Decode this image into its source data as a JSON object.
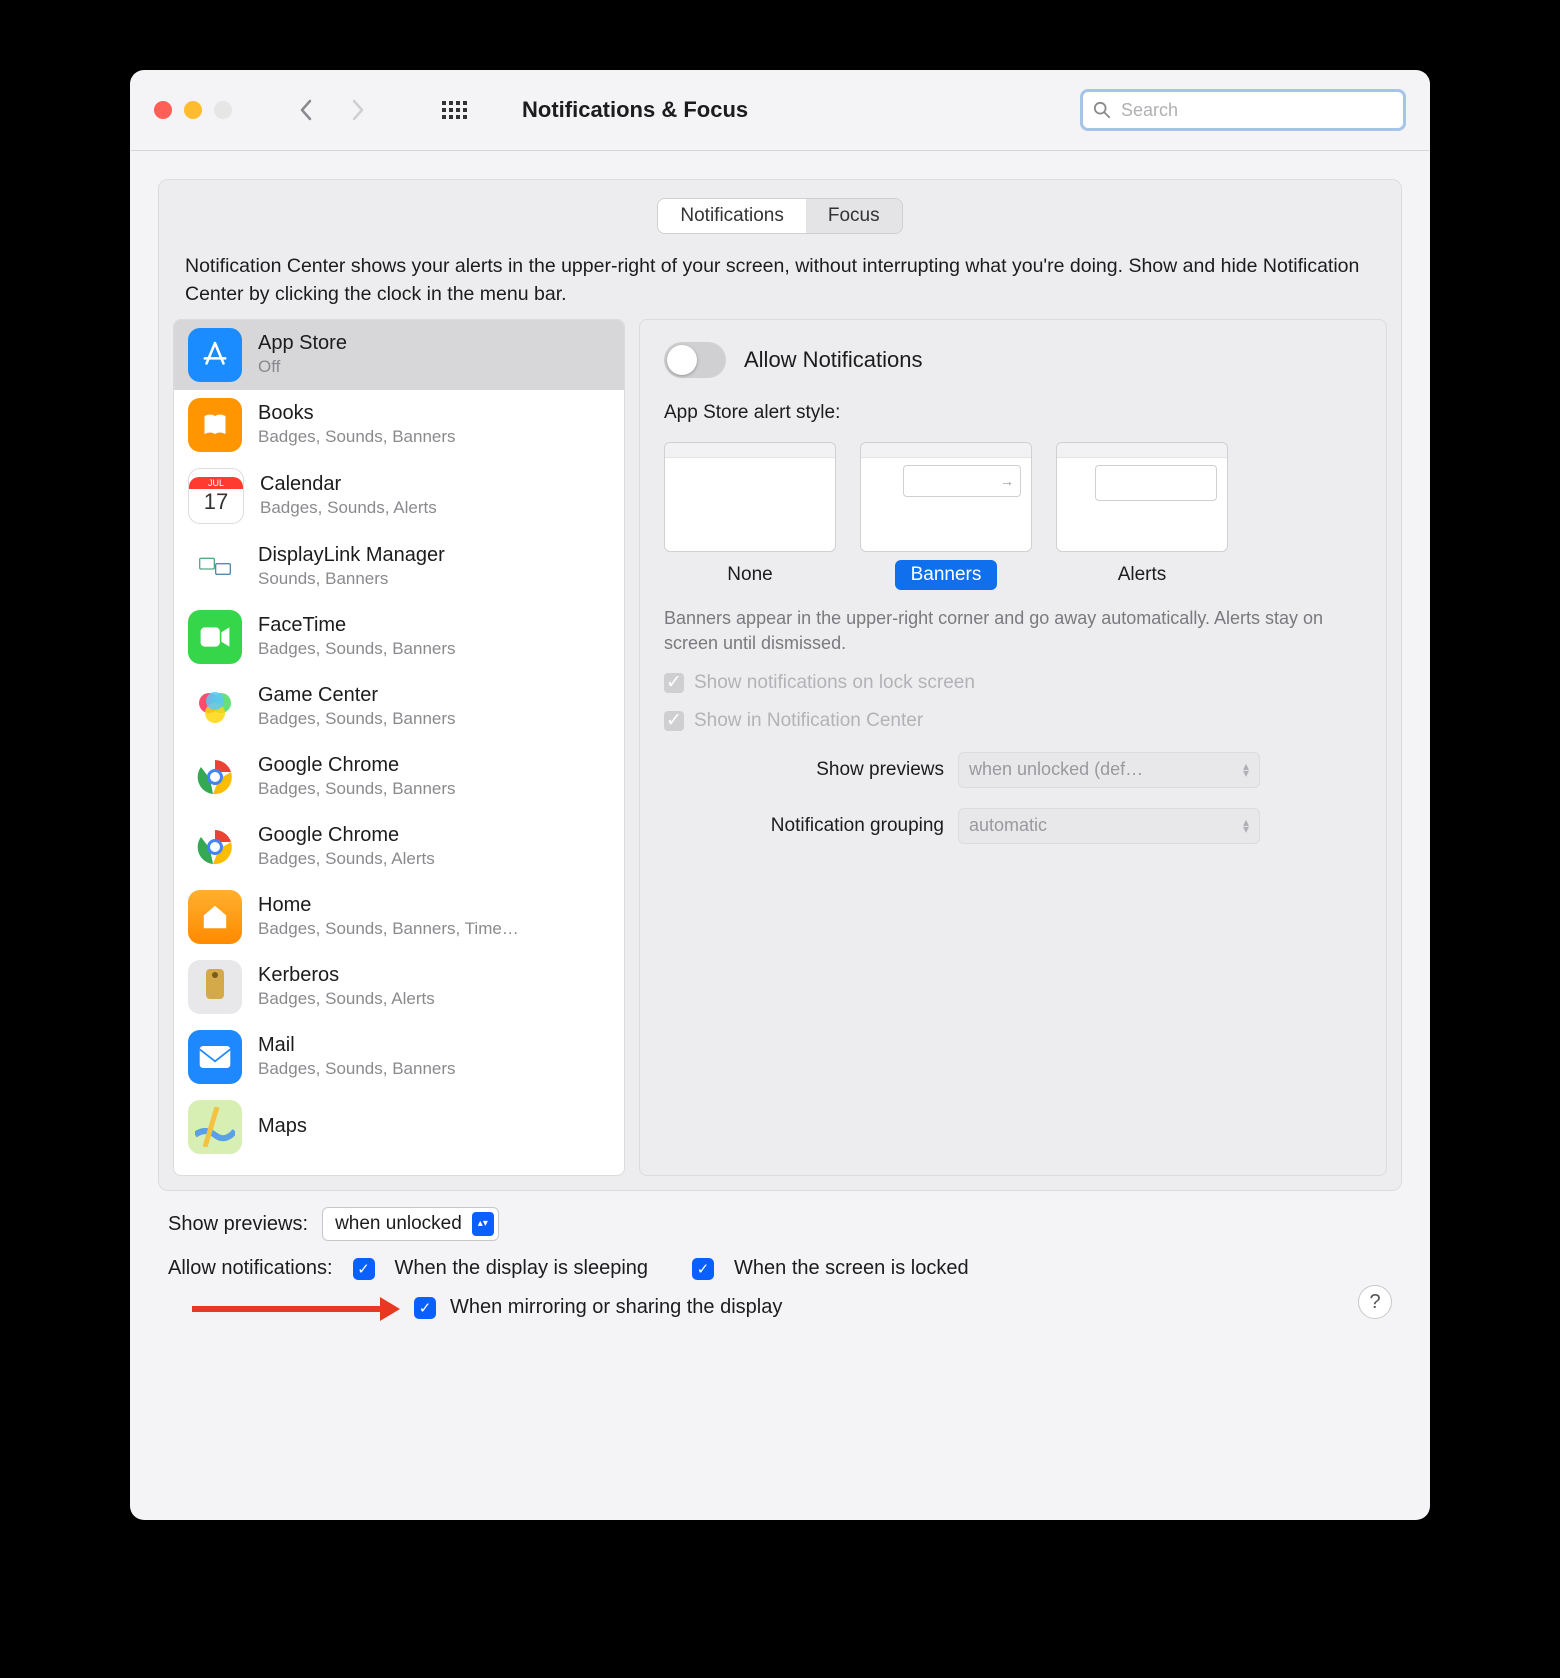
{
  "window": {
    "title": "Notifications & Focus",
    "search_placeholder": "Search"
  },
  "tabs": {
    "notifications": "Notifications",
    "focus": "Focus"
  },
  "description": "Notification Center shows your alerts in the upper-right of your screen, without interrupting what you're doing. Show and hide Notification Center by clicking the clock in the menu bar.",
  "apps": [
    {
      "name": "App Store",
      "sub": "Off",
      "icon": "appstore",
      "bg": "#1a8cff"
    },
    {
      "name": "Books",
      "sub": "Badges, Sounds, Banners",
      "icon": "books",
      "bg": "#ff9500"
    },
    {
      "name": "Calendar",
      "sub": "Badges, Sounds, Alerts",
      "icon": "calendar",
      "bg": "#ffffff"
    },
    {
      "name": "DisplayLink Manager",
      "sub": "Sounds, Banners",
      "icon": "displaylink",
      "bg": "#ffffff"
    },
    {
      "name": "FaceTime",
      "sub": "Badges, Sounds, Banners",
      "icon": "facetime",
      "bg": "#35d64a"
    },
    {
      "name": "Game Center",
      "sub": "Badges, Sounds, Banners",
      "icon": "gamecenter",
      "bg": "#ffffff"
    },
    {
      "name": "Google Chrome",
      "sub": "Badges, Sounds, Banners",
      "icon": "chrome",
      "bg": "#ffffff"
    },
    {
      "name": "Google Chrome",
      "sub": "Badges, Sounds, Alerts",
      "icon": "chrome",
      "bg": "#ffffff"
    },
    {
      "name": "Home",
      "sub": "Badges, Sounds, Banners, Time…",
      "icon": "home",
      "bg": "#ffb02e"
    },
    {
      "name": "Kerberos",
      "sub": "Badges, Sounds, Alerts",
      "icon": "kerberos",
      "bg": "#e8e8ea"
    },
    {
      "name": "Mail",
      "sub": "Badges, Sounds, Banners",
      "icon": "mail",
      "bg": "#1e88ff"
    },
    {
      "name": "Maps",
      "sub": "",
      "icon": "maps",
      "bg": "#d8efb3"
    }
  ],
  "detail": {
    "allow_label": "Allow Notifications",
    "style_heading": "App Store alert style:",
    "styles": {
      "none": "None",
      "banners": "Banners",
      "alerts": "Alerts"
    },
    "style_desc": "Banners appear in the upper-right corner and go away automatically. Alerts stay on screen until dismissed.",
    "lock_screen": "Show notifications on lock screen",
    "notif_center": "Show in Notification Center",
    "previews_label": "Show previews",
    "previews_value": "when unlocked (def…",
    "grouping_label": "Notification grouping",
    "grouping_value": "automatic"
  },
  "bottom": {
    "previews_label": "Show previews:",
    "previews_value": "when unlocked",
    "allow_label": "Allow notifications:",
    "sleeping": "When the display is sleeping",
    "locked": "When the screen is locked",
    "mirroring": "When mirroring or sharing the display"
  }
}
